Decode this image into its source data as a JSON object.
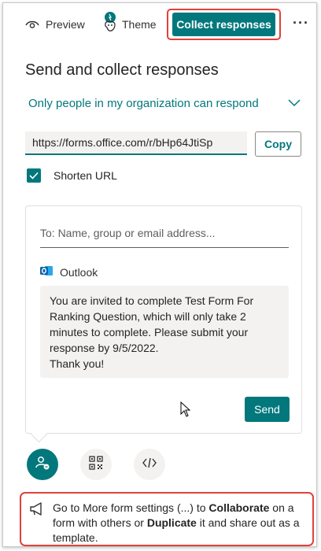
{
  "topbar": {
    "preview_label": "Preview",
    "theme_label": "Theme",
    "collect_label": "Collect responses",
    "more_label": "···"
  },
  "panel": {
    "title": "Send and collect responses",
    "audience": "Only people in my organization can respond"
  },
  "link": {
    "url": "https://forms.office.com/r/bHp64JtiSp",
    "copy_label": "Copy",
    "shorten_label": "Shorten URL",
    "shorten_checked": true
  },
  "share": {
    "to_placeholder": "To: Name, group or email address...",
    "outlook_label": "Outlook",
    "message_line1": "You are invited to complete Test Form For",
    "message_line2": "Ranking Question, which will only take 2",
    "message_line3": "minutes to complete. Please submit your",
    "message_line4": "response by 9/5/2022.",
    "message_line5": "Thank you!",
    "send_label": "Send"
  },
  "tip": {
    "t1": "Go to More form settings (...) to ",
    "b1": "Collaborate",
    "t2": " on a form with others or ",
    "b2": "Duplicate",
    "t3": " it and share out as a template."
  },
  "colors": {
    "accent": "#03787c",
    "highlight": "#e0413b",
    "field_bg": "#f3f2f1"
  }
}
